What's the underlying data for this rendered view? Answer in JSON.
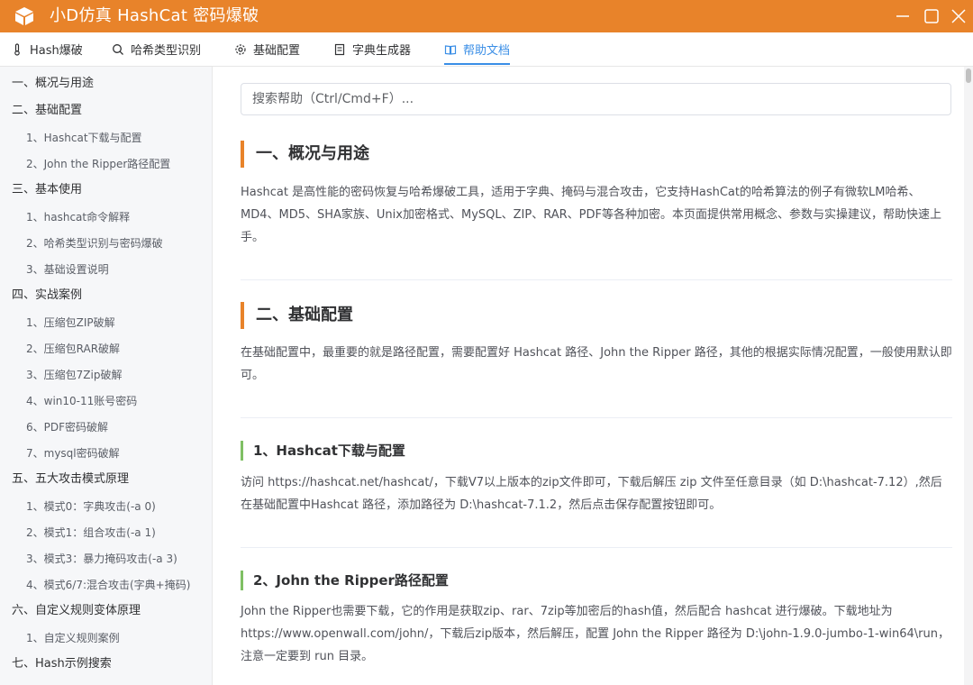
{
  "app": {
    "title": "小D仿真 HashCat 密码爆破",
    "logo_icon": "cube-icon",
    "accent_color": "#e8832a"
  },
  "tabs": [
    {
      "label": "Hash爆破",
      "icon": "thermometer-icon",
      "active": false
    },
    {
      "label": "哈希类型识别",
      "icon": "search-icon",
      "active": false
    },
    {
      "label": "基础配置",
      "icon": "gear-icon",
      "active": false
    },
    {
      "label": "字典生成器",
      "icon": "document-icon",
      "active": false
    },
    {
      "label": "帮助文档",
      "icon": "book-icon",
      "active": true
    }
  ],
  "sidebar": {
    "items": [
      {
        "label": "一、概况与用途",
        "level": 1
      },
      {
        "label": "二、基础配置",
        "level": 1
      },
      {
        "label": "1、Hashcat下载与配置",
        "level": 2
      },
      {
        "label": "2、John the Ripper路径配置",
        "level": 2
      },
      {
        "label": "三、基本使用",
        "level": 1
      },
      {
        "label": "1、hashcat命令解释",
        "level": 2
      },
      {
        "label": "2、哈希类型识别与密码爆破",
        "level": 2
      },
      {
        "label": "3、基础设置说明",
        "level": 2
      },
      {
        "label": "四、实战案例",
        "level": 1
      },
      {
        "label": "1、压缩包ZIP破解",
        "level": 2
      },
      {
        "label": "2、压缩包RAR破解",
        "level": 2
      },
      {
        "label": "3、压缩包7Zip破解",
        "level": 2
      },
      {
        "label": "4、win10-11账号密码",
        "level": 2
      },
      {
        "label": "6、PDF密码破解",
        "level": 2
      },
      {
        "label": "7、mysql密码破解",
        "level": 2
      },
      {
        "label": "五、五大攻击模式原理",
        "level": 1
      },
      {
        "label": "1、模式0：字典攻击(-a 0)",
        "level": 2
      },
      {
        "label": "2、模式1：组合攻击(-a 1)",
        "level": 2
      },
      {
        "label": "3、模式3：暴力掩码攻击(-a 3)",
        "level": 2
      },
      {
        "label": "4、模式6/7:混合攻击(字典+掩码)",
        "level": 2
      },
      {
        "label": "六、自定义规则变体原理",
        "level": 1
      },
      {
        "label": "1、自定义规则案例",
        "level": 2
      },
      {
        "label": "七、Hash示例搜索",
        "level": 1
      }
    ]
  },
  "search": {
    "placeholder": "搜索帮助（Ctrl/Cmd+F）..."
  },
  "content": {
    "section1": {
      "title": "一、概况与用途",
      "body": "Hashcat 是高性能的密码恢复与哈希爆破工具，适用于字典、掩码与混合攻击，它支持HashCat的哈希算法的例子有微软LM哈希、MD4、MD5、SHA家族、Unix加密格式、MySQL、ZIP、RAR、PDF等各种加密。本页面提供常用概念、参数与实操建议，帮助快速上手。"
    },
    "section2": {
      "title": "二、基础配置",
      "body": "在基础配置中，最重要的就是路径配置，需要配置好 Hashcat 路径、John the Ripper 路径，其他的根据实际情况配置，一般使用默认即可。"
    },
    "sub1": {
      "title": "1、Hashcat下载与配置",
      "body": "访问 https://hashcat.net/hashcat/，下载V7以上版本的zip文件即可，下载后解压 zip 文件至任意目录（如 D:\\hashcat-7.12）,然后在基础配置中Hashcat 路径，添加路径为 D:\\hashcat-7.1.2，然后点击保存配置按钮即可。"
    },
    "sub2": {
      "title": "2、John the Ripper路径配置",
      "body": "John the Ripper也需要下载，它的作用是获取zip、rar、7zip等加密后的hash值，然后配合 hashcat 进行爆破。下载地址为https://www.openwall.com/john/，下载后zip版本，然后解压，配置 John the Ripper 路径为 D:\\john-1.9.0-jumbo-1-win64\\run，注意一定要到 run 目录。"
    }
  }
}
